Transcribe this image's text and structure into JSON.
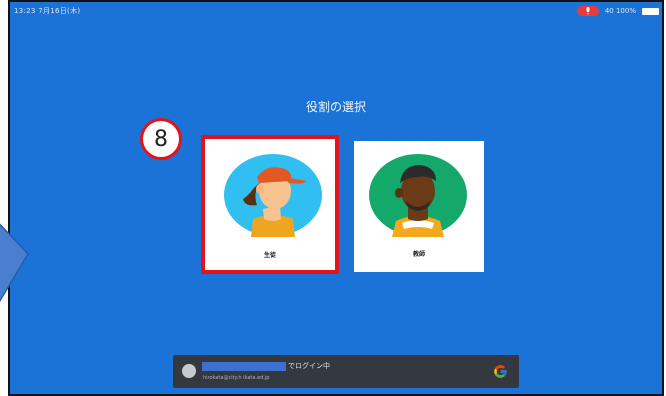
{
  "status_bar": {
    "left_text": "13:23  7月16日(木)",
    "right_text": "40  100%",
    "icons": [
      "mic-recording-icon",
      "signal-icon",
      "battery-icon"
    ]
  },
  "screen": {
    "title": "役割の選択"
  },
  "roles": [
    {
      "label": "生徒",
      "selected": true
    },
    {
      "label": "教師",
      "selected": false
    }
  ],
  "annotation": {
    "step_number": "8"
  },
  "account": {
    "suffix": "でログイン中",
    "email": "hirokata@city.h ikata.ed.jp",
    "provider_icon": "google-g-icon"
  },
  "colors": {
    "background": "#1b73d8",
    "highlight": "#e4121a",
    "account_bar": "#33393e"
  }
}
